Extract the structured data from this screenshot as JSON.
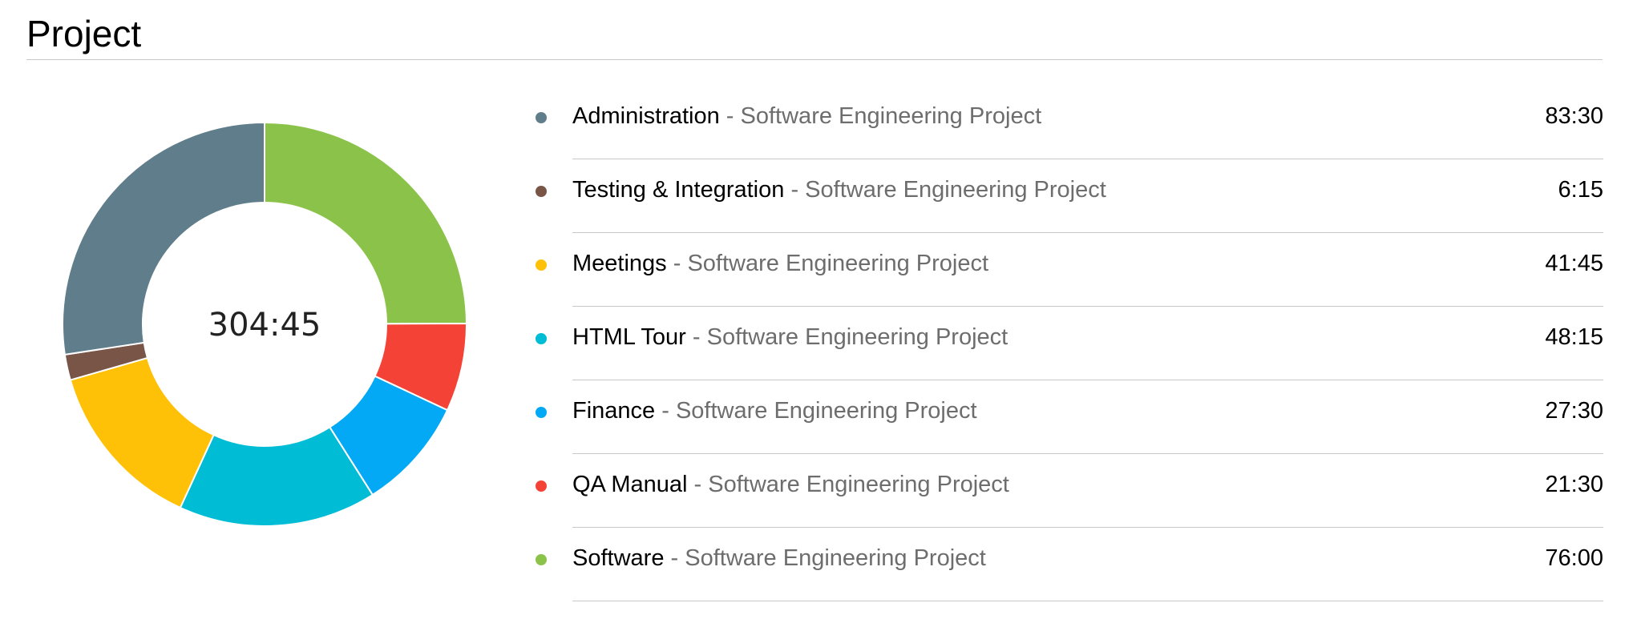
{
  "page": {
    "title": "Project"
  },
  "chart_data": {
    "type": "pie",
    "variant": "donut",
    "center_label": "304:45",
    "categories": [
      "Administration",
      "Testing & Integration",
      "Meetings",
      "HTML Tour",
      "Finance",
      "QA Manual",
      "Software"
    ],
    "values": [
      83.5,
      6.25,
      41.75,
      48.25,
      27.5,
      21.5,
      76.0
    ],
    "value_labels": [
      "83:30",
      "6:15",
      "41:45",
      "48:15",
      "27:30",
      "21:30",
      "76:00"
    ],
    "colors": [
      "#607d8b",
      "#795548",
      "#ffc107",
      "#00bcd4",
      "#03a9f4",
      "#f44336",
      "#8bc34a"
    ],
    "slice_order": [
      "Software",
      "QA Manual",
      "Finance",
      "HTML Tour",
      "Meetings",
      "Testing & Integration",
      "Administration"
    ],
    "legend_placement": "right"
  },
  "legend": {
    "separator": " - ",
    "items": [
      {
        "name": "Administration",
        "project": "Software Engineering Project",
        "value": "83:30",
        "color": "#607d8b"
      },
      {
        "name": "Testing & Integration",
        "project": "Software Engineering Project",
        "value": "6:15",
        "color": "#795548"
      },
      {
        "name": "Meetings",
        "project": "Software Engineering Project",
        "value": "41:45",
        "color": "#ffc107"
      },
      {
        "name": "HTML Tour",
        "project": "Software Engineering Project",
        "value": "48:15",
        "color": "#00bcd4"
      },
      {
        "name": "Finance",
        "project": "Software Engineering Project",
        "value": "27:30",
        "color": "#03a9f4"
      },
      {
        "name": "QA Manual",
        "project": "Software Engineering Project",
        "value": "21:30",
        "color": "#f44336"
      },
      {
        "name": "Software",
        "project": "Software Engineering Project",
        "value": "76:00",
        "color": "#8bc34a"
      }
    ]
  }
}
